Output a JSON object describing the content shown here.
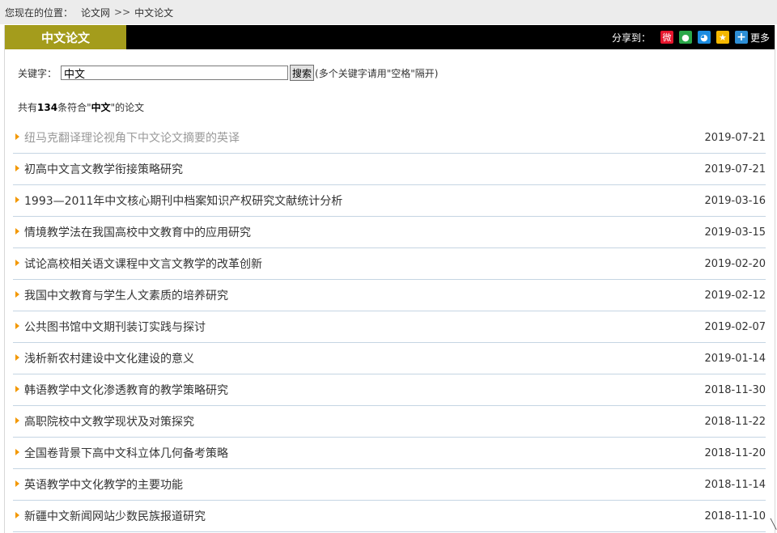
{
  "breadcrumb": {
    "prefix": "您现在的位置：",
    "home": "论文网",
    "separator": ">>",
    "current": "中文论文"
  },
  "section": {
    "title": "中文论文"
  },
  "share": {
    "label": "分享到：",
    "more": "更多",
    "icons": [
      "weibo-icon",
      "wechat-icon",
      "qq-icon",
      "qzone-icon",
      "more-icon"
    ]
  },
  "search": {
    "label": "关键字：",
    "value": "中文",
    "button": "搜索",
    "hint": "(多个关键字请用\"空格\"隔开)"
  },
  "results": {
    "prefix": "共有",
    "count": "134",
    "middle": "条符合\"",
    "keyword": "中文",
    "suffix": "\"的论文"
  },
  "articles": [
    {
      "title": "纽马克翻译理论视角下中文论文摘要的英译",
      "date": "2019-07-21",
      "visited": true
    },
    {
      "title": "初高中文言文教学衔接策略研究",
      "date": "2019-07-21"
    },
    {
      "title": "1993—2011年中文核心期刊中档案知识产权研究文献统计分析",
      "date": "2019-03-16"
    },
    {
      "title": "情境教学法在我国高校中文教育中的应用研究",
      "date": "2019-03-15"
    },
    {
      "title": "试论高校相关语文课程中文言文教学的改革创新",
      "date": "2019-02-20"
    },
    {
      "title": "我国中文教育与学生人文素质的培养研究",
      "date": "2019-02-12"
    },
    {
      "title": "公共图书馆中文期刊装订实践与探讨",
      "date": "2019-02-07"
    },
    {
      "title": "浅析新农村建设中文化建设的意义",
      "date": "2019-01-14"
    },
    {
      "title": "韩语教学中文化渗透教育的教学策略研究",
      "date": "2018-11-30"
    },
    {
      "title": "高职院校中文教学现状及对策探究",
      "date": "2018-11-22"
    },
    {
      "title": "全国卷背景下高中文科立体几何备考策略",
      "date": "2018-11-20"
    },
    {
      "title": "英语教学中文化教学的主要功能",
      "date": "2018-11-14"
    },
    {
      "title": "新疆中文新闻网站少数民族报道研究",
      "date": "2018-11-10"
    }
  ]
}
